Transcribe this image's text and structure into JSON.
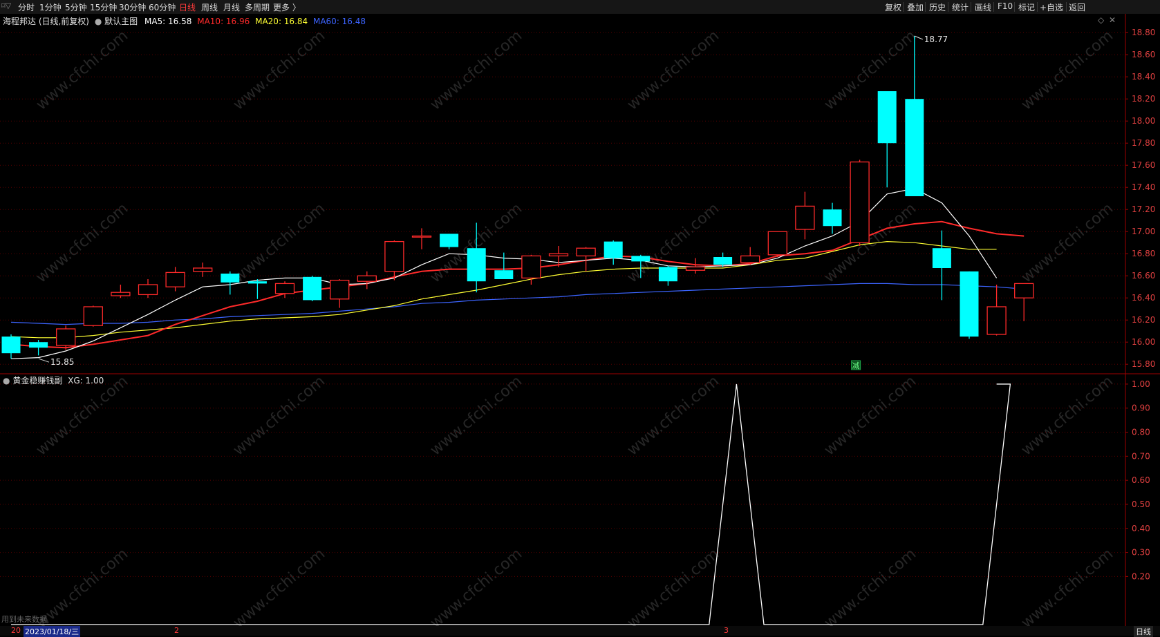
{
  "toolbar": {
    "app_icon": "menu-icon",
    "periods": [
      {
        "label": "分时",
        "active": false
      },
      {
        "label": "1分钟",
        "active": false
      },
      {
        "label": "5分钟",
        "active": false
      },
      {
        "label": "15分钟",
        "active": false
      },
      {
        "label": "30分钟",
        "active": false
      },
      {
        "label": "60分钟",
        "active": false
      },
      {
        "label": "日线",
        "active": true
      },
      {
        "label": "周线",
        "active": false
      },
      {
        "label": "月线",
        "active": false
      },
      {
        "label": "多周期",
        "active": false
      },
      {
        "label": "更多 〉",
        "active": false
      }
    ],
    "right": [
      "复权",
      "叠加",
      "历史",
      "统计",
      "画线",
      "F10",
      "标记",
      "+自选",
      "返回"
    ]
  },
  "main_panel": {
    "title": "海程邦达 (日线,前复权)",
    "indicator_label": "默认主图",
    "ma": [
      {
        "label": "MA5: 16.58",
        "color": "#ffffff"
      },
      {
        "label": "MA10: 16.96",
        "color": "#ff2a2a"
      },
      {
        "label": "MA20: 16.84",
        "color": "#ffff33"
      },
      {
        "label": "MA60: 16.48",
        "color": "#3c64ff"
      }
    ],
    "high_label": "18.77",
    "low_label": "15.85",
    "marker_text": "减",
    "y_ticks": [
      "18.80",
      "18.60",
      "18.40",
      "18.20",
      "18.00",
      "17.80",
      "17.60",
      "17.40",
      "17.20",
      "17.00",
      "16.80",
      "16.60",
      "16.40",
      "16.20",
      "16.00",
      "15.80"
    ]
  },
  "sub_panel": {
    "title": "黄金稳赚钱副",
    "value_label": "XG: 1.00",
    "y_ticks": [
      "1.00",
      "0.90",
      "0.80",
      "0.70",
      "0.60",
      "0.50",
      "0.40",
      "0.30",
      "0.20"
    ]
  },
  "footer": {
    "note": "用到未来数据",
    "year_prefix": "20",
    "date": "2023/01/18/三",
    "month_marks": [
      "2",
      "3"
    ],
    "period_label": "日线"
  },
  "watermark": "www.cfchi.com",
  "colors": {
    "up": "#ff2a2a",
    "down": "#00ffff",
    "grid": "#5a0000",
    "axis": "#a00000"
  },
  "chart_data": {
    "type": "candlestick",
    "candles": [
      {
        "o": 16.05,
        "h": 16.07,
        "l": 15.85,
        "c": 15.9
      },
      {
        "o": 16.0,
        "h": 16.02,
        "l": 15.88,
        "c": 15.95
      },
      {
        "o": 15.97,
        "h": 16.15,
        "l": 15.93,
        "c": 16.12
      },
      {
        "o": 16.15,
        "h": 16.33,
        "l": 16.14,
        "c": 16.32
      },
      {
        "o": 16.42,
        "h": 16.52,
        "l": 16.4,
        "c": 16.45
      },
      {
        "o": 16.43,
        "h": 16.57,
        "l": 16.4,
        "c": 16.52
      },
      {
        "o": 16.5,
        "h": 16.68,
        "l": 16.46,
        "c": 16.63
      },
      {
        "o": 16.64,
        "h": 16.72,
        "l": 16.59,
        "c": 16.67
      },
      {
        "o": 16.62,
        "h": 16.64,
        "l": 16.43,
        "c": 16.54
      },
      {
        "o": 16.55,
        "h": 16.57,
        "l": 16.39,
        "c": 16.53
      },
      {
        "o": 16.44,
        "h": 16.55,
        "l": 16.4,
        "c": 16.53
      },
      {
        "o": 16.59,
        "h": 16.6,
        "l": 16.37,
        "c": 16.38
      },
      {
        "o": 16.39,
        "h": 16.57,
        "l": 16.31,
        "c": 16.56
      },
      {
        "o": 16.55,
        "h": 16.64,
        "l": 16.48,
        "c": 16.6
      },
      {
        "o": 16.64,
        "h": 16.92,
        "l": 16.56,
        "c": 16.91
      },
      {
        "o": 16.95,
        "h": 17.03,
        "l": 16.84,
        "c": 16.96
      },
      {
        "o": 16.98,
        "h": 16.98,
        "l": 16.84,
        "c": 16.86
      },
      {
        "o": 16.85,
        "h": 17.08,
        "l": 16.45,
        "c": 16.55
      },
      {
        "o": 16.65,
        "h": 16.81,
        "l": 16.58,
        "c": 16.57
      },
      {
        "o": 16.58,
        "h": 16.79,
        "l": 16.52,
        "c": 16.78
      },
      {
        "o": 16.78,
        "h": 16.87,
        "l": 16.68,
        "c": 16.8
      },
      {
        "o": 16.78,
        "h": 16.86,
        "l": 16.64,
        "c": 16.85
      },
      {
        "o": 16.91,
        "h": 16.92,
        "l": 16.7,
        "c": 16.76
      },
      {
        "o": 16.78,
        "h": 16.79,
        "l": 16.58,
        "c": 16.73
      },
      {
        "o": 16.68,
        "h": 16.69,
        "l": 16.51,
        "c": 16.55
      },
      {
        "o": 16.65,
        "h": 16.76,
        "l": 16.62,
        "c": 16.68
      },
      {
        "o": 16.77,
        "h": 16.81,
        "l": 16.68,
        "c": 16.7
      },
      {
        "o": 16.72,
        "h": 16.86,
        "l": 16.7,
        "c": 16.78
      },
      {
        "o": 16.79,
        "h": 17.0,
        "l": 16.77,
        "c": 17.0
      },
      {
        "o": 17.02,
        "h": 17.36,
        "l": 16.93,
        "c": 17.23
      },
      {
        "o": 17.2,
        "h": 17.26,
        "l": 16.98,
        "c": 17.05
      },
      {
        "o": 16.9,
        "h": 17.65,
        "l": 16.87,
        "c": 17.63
      },
      {
        "o": 18.27,
        "h": 18.27,
        "l": 17.4,
        "c": 17.8
      },
      {
        "o": 18.2,
        "h": 18.77,
        "l": 17.32,
        "c": 17.32
      },
      {
        "o": 16.85,
        "h": 17.01,
        "l": 16.38,
        "c": 16.67
      },
      {
        "o": 16.64,
        "h": 16.64,
        "l": 16.03,
        "c": 16.05
      },
      {
        "o": 16.07,
        "h": 16.52,
        "l": 16.06,
        "c": 16.32
      },
      {
        "o": 16.4,
        "h": 16.53,
        "l": 16.19,
        "c": 16.53
      }
    ],
    "ma5": [
      15.85,
      15.86,
      15.92,
      16.01,
      16.13,
      16.25,
      16.38,
      16.5,
      16.52,
      16.56,
      16.58,
      16.58,
      16.52,
      16.53,
      16.58,
      16.7,
      16.8,
      16.79,
      16.76,
      16.75,
      16.72,
      16.74,
      16.76,
      16.74,
      16.69,
      16.68,
      16.69,
      16.7,
      16.76,
      16.87,
      16.96,
      17.09,
      17.34,
      17.39,
      17.26,
      16.96,
      16.58
    ],
    "ma10": [
      15.98,
      15.96,
      15.95,
      15.98,
      16.02,
      16.06,
      16.16,
      16.24,
      16.32,
      16.37,
      16.44,
      16.47,
      16.5,
      16.53,
      16.59,
      16.64,
      16.66,
      16.66,
      16.66,
      16.67,
      16.7,
      16.74,
      16.78,
      16.77,
      16.73,
      16.7,
      16.69,
      16.71,
      16.78,
      16.8,
      16.83,
      16.93,
      17.03,
      17.07,
      17.09,
      17.03,
      16.98,
      16.96
    ],
    "ma20": [
      16.05,
      16.04,
      16.04,
      16.06,
      16.09,
      16.11,
      16.13,
      16.16,
      16.19,
      16.21,
      16.22,
      16.23,
      16.25,
      16.29,
      16.33,
      16.39,
      16.43,
      16.47,
      16.52,
      16.57,
      16.61,
      16.64,
      16.66,
      16.67,
      16.67,
      16.67,
      16.67,
      16.7,
      16.74,
      16.76,
      16.82,
      16.88,
      16.91,
      16.9,
      16.87,
      16.84,
      16.84
    ],
    "ma60": [
      16.18,
      16.17,
      16.16,
      16.17,
      16.17,
      16.18,
      16.2,
      16.21,
      16.23,
      16.24,
      16.25,
      16.26,
      16.28,
      16.3,
      16.32,
      16.35,
      16.36,
      16.38,
      16.39,
      16.4,
      16.41,
      16.43,
      16.44,
      16.45,
      16.46,
      16.47,
      16.48,
      16.49,
      16.5,
      16.51,
      16.52,
      16.53,
      16.53,
      16.52,
      16.52,
      16.51,
      16.5,
      16.48
    ],
    "xg_line": [
      {
        "i": 0,
        "v": 0
      },
      {
        "i": 25.5,
        "v": 0
      },
      {
        "i": 26.5,
        "v": 1
      },
      {
        "i": 27.5,
        "v": 0
      },
      {
        "i": 35.5,
        "v": 0
      },
      {
        "i": 36.5,
        "v": 1
      }
    ],
    "ylim_main": [
      15.72,
      18.87
    ],
    "ylim_sub": [
      0,
      1.04
    ]
  }
}
